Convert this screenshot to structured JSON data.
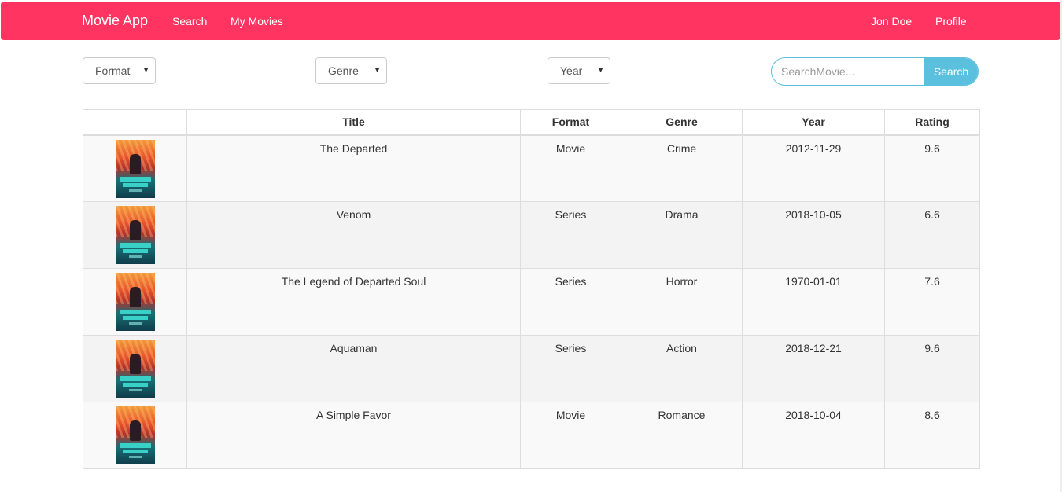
{
  "nav": {
    "brand": "Movie App",
    "links": [
      "Search",
      "My Movies"
    ],
    "user": "Jon Doe",
    "profile": "Profile",
    "bg_color": "#ff3461"
  },
  "filters": {
    "format": "Format",
    "genre": "Genre",
    "year": "Year"
  },
  "search": {
    "placeholder": "SearchMovie...",
    "button": "Search",
    "accent_color": "#5bc0de"
  },
  "table": {
    "columns": [
      "",
      "Title",
      "Format",
      "Genre",
      "Year",
      "Rating"
    ],
    "rows": [
      {
        "title": "The Departed",
        "format": "Movie",
        "genre": "Crime",
        "year": "2012-11-29",
        "rating": "9.6"
      },
      {
        "title": "Venom",
        "format": "Series",
        "genre": "Drama",
        "year": "2018-10-05",
        "rating": "6.6"
      },
      {
        "title": "The Legend of Departed Soul",
        "format": "Series",
        "genre": "Horror",
        "year": "1970-01-01",
        "rating": "7.6"
      },
      {
        "title": "Aquaman",
        "format": "Series",
        "genre": "Action",
        "year": "2018-12-21",
        "rating": "9.6"
      },
      {
        "title": "A Simple Favor",
        "format": "Movie",
        "genre": "Romance",
        "year": "2018-10-04",
        "rating": "8.6"
      }
    ]
  }
}
